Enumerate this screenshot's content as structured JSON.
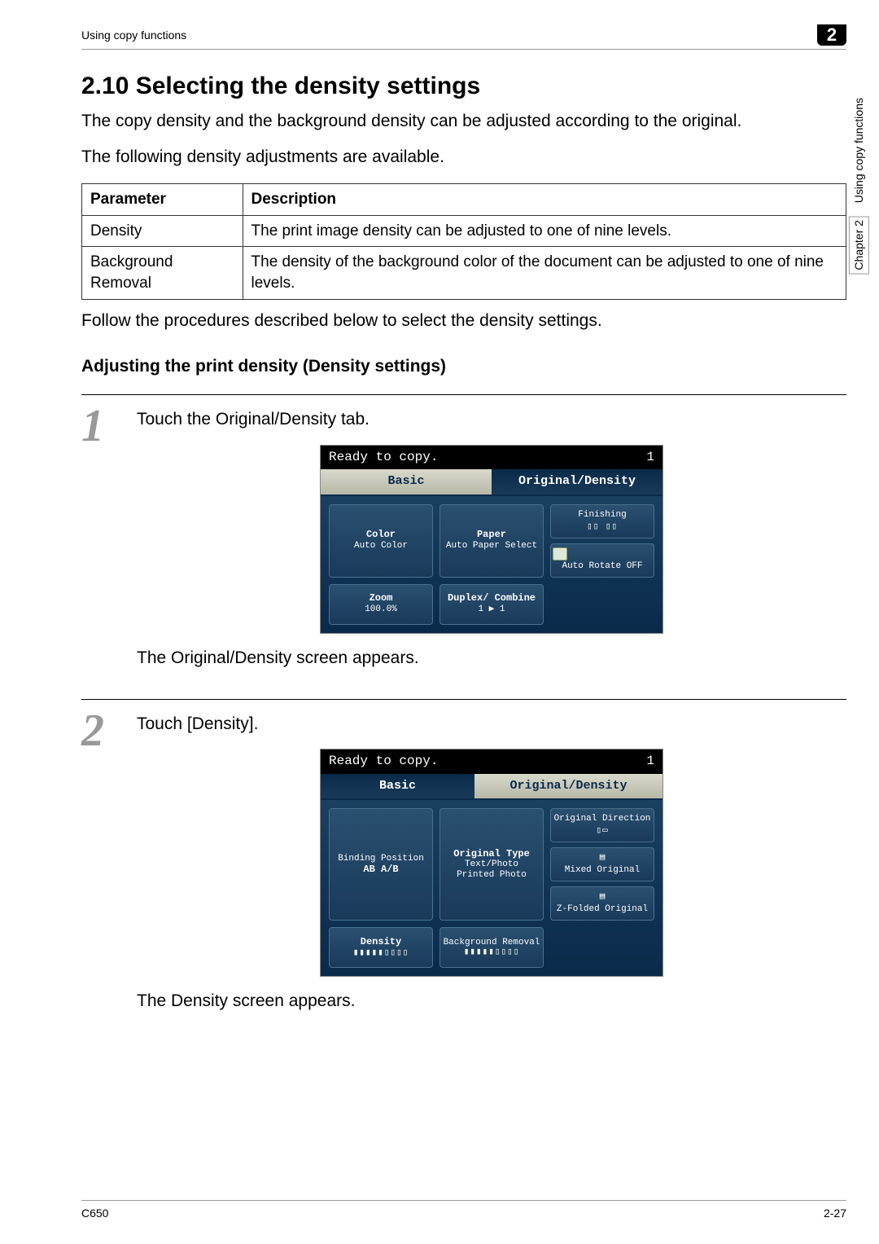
{
  "header": {
    "left": "Using copy functions",
    "badge": "2"
  },
  "side": {
    "chap": "Chapter 2",
    "label": "Using copy functions"
  },
  "title": "2.10   Selecting the density settings",
  "intro1": "The copy density and the background density can be adjusted according to the original.",
  "intro2": "The following density adjustments are available.",
  "table": {
    "h1": "Parameter",
    "h2": "Description",
    "r1c1": "Density",
    "r1c2": "The print image density can be adjusted to one of nine levels.",
    "r2c1": "Background Removal",
    "r2c2": "The density of the background color of the document can be adjusted to one of nine levels."
  },
  "follow": "Follow the procedures described below to select the density settings.",
  "sub": "Adjusting the print density (Density settings)",
  "steps": {
    "s1": {
      "num": "1",
      "text": "Touch the Original/Density tab.",
      "after": "The Original/Density screen appears."
    },
    "s2": {
      "num": "2",
      "text": "Touch [Density].",
      "after": "The Density screen appears."
    }
  },
  "panel1": {
    "status": "Ready to copy.",
    "count": "1",
    "tabBasic": "Basic",
    "tabOD": "Original/Density",
    "color": {
      "t": "Color",
      "s": "Auto Color"
    },
    "paper": {
      "t": "Paper",
      "s": "Auto Paper Select"
    },
    "finishing": "Finishing",
    "zoom": {
      "t": "Zoom",
      "s": "100.0%"
    },
    "duplex": {
      "t": "Duplex/ Combine",
      "s": "1 ▶ 1"
    },
    "autorotate": "Auto Rotate OFF"
  },
  "panel2": {
    "status": "Ready to copy.",
    "count": "1",
    "tabBasic": "Basic",
    "tabOD": "Original/Density",
    "binding": {
      "t": "Binding Position",
      "s": "AB  A/B"
    },
    "origtype": {
      "t": "Original Type",
      "s1": "Text/Photo",
      "s2": "Printed Photo"
    },
    "origdir": "Original Direction",
    "density": "Density",
    "bgrem": "Background Removal",
    "mixed": "Mixed Original",
    "zfold": "Z-Folded Original"
  },
  "footer": {
    "left": "C650",
    "right": "2-27"
  }
}
